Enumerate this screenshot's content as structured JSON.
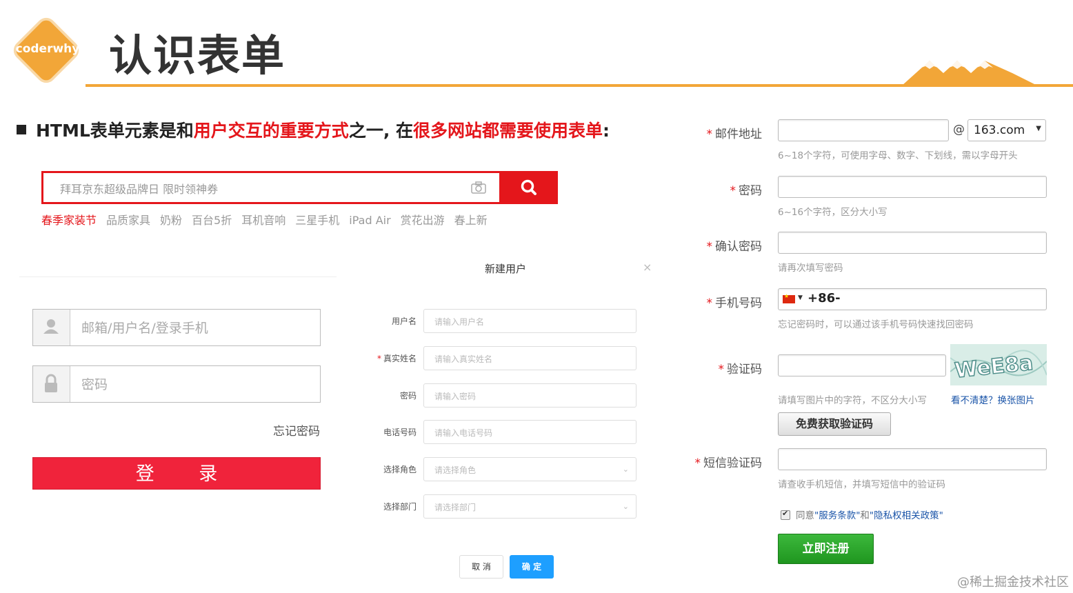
{
  "header": {
    "logo_text": "coderwhy",
    "title": "认识表单"
  },
  "heading": {
    "part1": "HTML表单元素是和",
    "part2": "用户交互的重要方式",
    "part3": "之一, 在",
    "part4": "很多网站都需要使用表单",
    "part5": ":"
  },
  "jd_search": {
    "placeholder": "拜耳京东超级品牌日 限时领神券",
    "hot_words": [
      "春季家装节",
      "品质家具",
      "奶粉",
      "百台5折",
      "耳机音响",
      "三星手机",
      "iPad Air",
      "赏花出游",
      "春上新"
    ]
  },
  "login": {
    "username_placeholder": "邮箱/用户名/登录手机",
    "password_placeholder": "密码",
    "forgot_label": "忘记密码",
    "submit_label": "登 录"
  },
  "dialog": {
    "title": "新建用户",
    "close": "×",
    "fields": [
      {
        "label": "用户名",
        "placeholder": "请输入用户名",
        "required": false
      },
      {
        "label": "真实姓名",
        "placeholder": "请输入真实姓名",
        "required": true
      },
      {
        "label": "密码",
        "placeholder": "请输入密码",
        "required": false
      },
      {
        "label": "电话号码",
        "placeholder": "请输入电话号码",
        "required": false
      },
      {
        "label": "选择角色",
        "placeholder": "请选择角色",
        "required": false
      },
      {
        "label": "选择部门",
        "placeholder": "请选择部门",
        "required": false
      }
    ],
    "cancel_label": "取 消",
    "ok_label": "确 定"
  },
  "register": {
    "star": "*",
    "email_label": "邮件地址",
    "at": "@",
    "domain": "163.com",
    "email_hint": "6~18个字符，可使用字母、数字、下划线，需以字母开头",
    "password_label": "密码",
    "password_hint": "6~16个字符，区分大小写",
    "confirm_label": "确认密码",
    "confirm_hint": "请再次填写密码",
    "phone_label": "手机号码",
    "phone_prefix": "+86-",
    "phone_hint": "忘记密码时，可以通过该手机号码快速找回密码",
    "captcha_label": "验证码",
    "captcha_hint": "请填写图片中的字符，不区分大小写",
    "captcha_link": "看不清楚？换张图片",
    "get_code_label": "免费获取验证码",
    "sms_label": "短信验证码",
    "sms_hint": "请查收手机短信，并填写短信中的验证码",
    "agree_prefix": "同意",
    "agree_terms": "\"服务条款\"",
    "agree_and": "和",
    "agree_privacy": "\"隐私权相关政策\"",
    "submit_label": "立即注册"
  },
  "watermark": "@稀土掘金技术社区",
  "colors": {
    "accent": "#f2a638",
    "jd_red": "#e4161b",
    "login_red": "#f0233b",
    "dialog_blue": "#1e9fff",
    "register_green": "#2aa52a"
  }
}
